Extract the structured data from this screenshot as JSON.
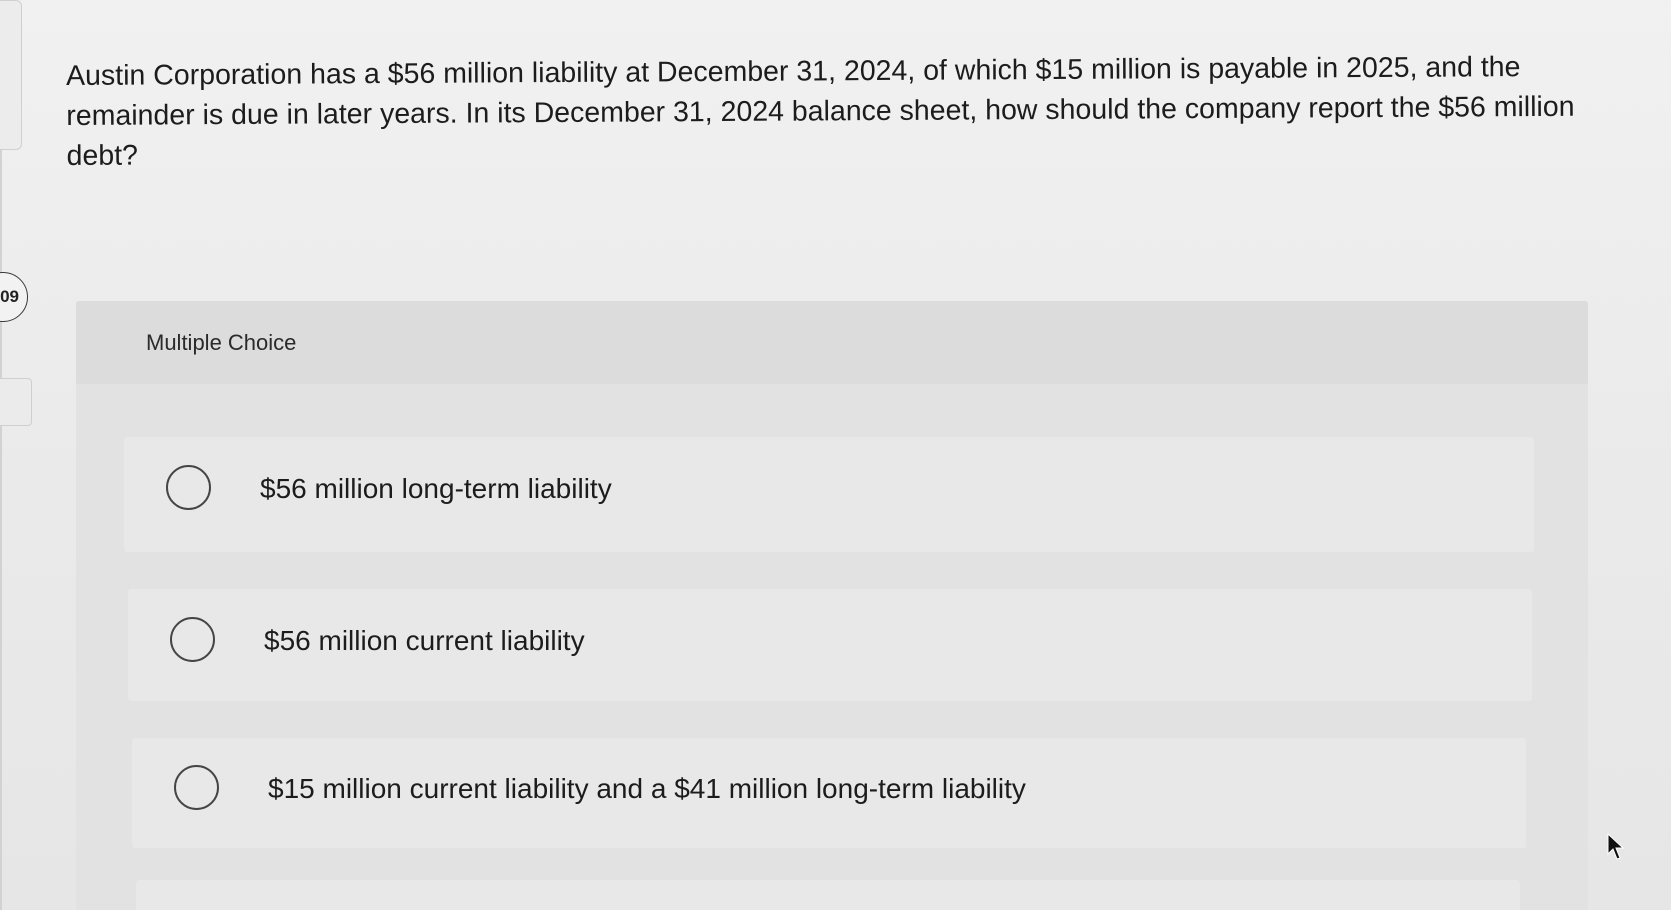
{
  "question": {
    "number": "09",
    "text": "Austin Corporation has a $56 million liability at December 31, 2024, of which $15 million is payable in 2025, and the remainder is due in later years. In its December 31, 2024 balance sheet, how should the company report the $56 million debt?"
  },
  "multiple_choice": {
    "label": "Multiple Choice",
    "options": [
      {
        "text": "$56 million long-term liability",
        "selected": false
      },
      {
        "text": "$56 million current liability",
        "selected": false
      },
      {
        "text": "$15 million current liability and a $41 million long-term liability",
        "selected": false
      }
    ]
  },
  "icons": {
    "radio": "radio-unselected-icon",
    "cursor": "mouse-pointer-icon"
  },
  "colors": {
    "background": "#ececec",
    "panel": "#e2e2e2",
    "option_card": "#e8e8e8",
    "text": "#1c1c1c"
  }
}
